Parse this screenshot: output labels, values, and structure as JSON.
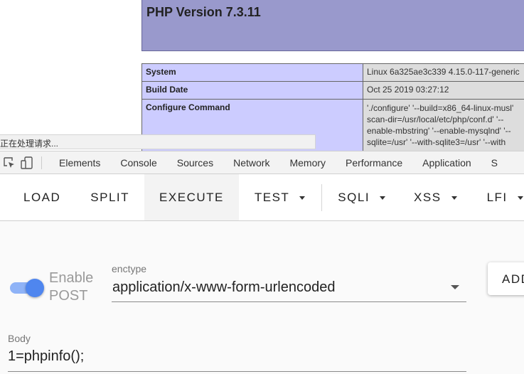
{
  "php_page": {
    "title": "PHP Version 7.3.11",
    "rows": [
      {
        "key": "System",
        "value": "Linux 6a325ae3c339 4.15.0-117-generic"
      },
      {
        "key": "Build Date",
        "value": "Oct 25 2019 03:27:12"
      },
      {
        "key": "Configure Command",
        "value_lines": [
          "'./configure' '--build=x86_64-linux-musl'",
          "scan-dir=/usr/local/etc/php/conf.d' '--",
          "enable-mbstring' '--enable-mysqlnd' '--",
          "sqlite=/usr' '--with-sqlite3=/usr' '--with"
        ]
      }
    ],
    "status_text": "正在处理请求..."
  },
  "devtools": {
    "tabs": [
      "Elements",
      "Console",
      "Sources",
      "Network",
      "Memory",
      "Performance",
      "Application",
      "S"
    ]
  },
  "hackbar": {
    "buttons": {
      "load": "LOAD",
      "split": "SPLIT",
      "execute": "EXECUTE",
      "test": "TEST",
      "sqli": "SQLI",
      "xss": "XSS",
      "lfi": "LFI"
    },
    "enable_post": {
      "line1": "Enable",
      "line2": "POST",
      "enabled": true
    },
    "enctype": {
      "label": "enctype",
      "value": "application/x-www-form-urlencoded"
    },
    "add_button": "ADD",
    "body": {
      "label": "Body",
      "value": "1=phpinfo();"
    }
  },
  "colors": {
    "php_header": "#9999cc",
    "php_key_cell": "#ccccff",
    "php_value_cell": "#dddddd",
    "toggle_knob": "#4f86ef",
    "toggle_track": "#8fb3f7"
  }
}
